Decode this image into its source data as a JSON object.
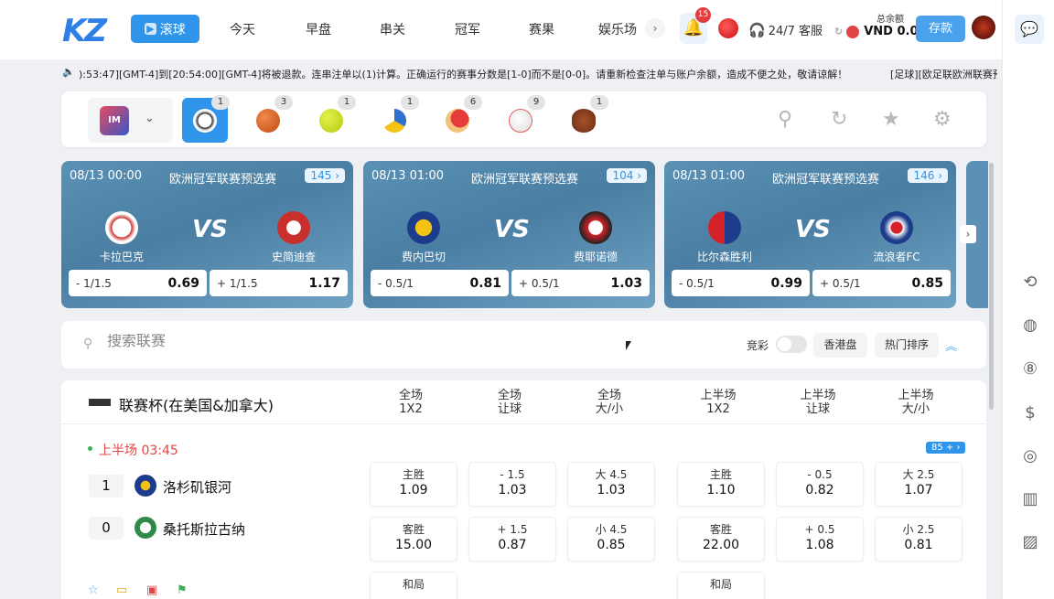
{
  "header": {
    "logo": "KZ",
    "active_nav": "滚球",
    "nav": [
      "今天",
      "早盘",
      "串关",
      "冠军",
      "赛果",
      "娱乐场"
    ],
    "notifications": "15",
    "support": "24/7 客服",
    "balance_label": "总余额",
    "balance": "VND 0.00",
    "deposit": "存款"
  },
  "marquee": {
    "text": "):53:47][GMT-4]到[20:54:00][GMT-4]将被退款。连串注单以(1)计算。正确运行的赛事分数是[1-0]而不是[0-0]。请重新检查注单与账户余额，造成不便之处，敬请谅解！",
    "text2": "[足球][欧足联欧洲联赛预"
  },
  "sports": {
    "counts": [
      "1",
      "3",
      "1",
      "1",
      "6",
      "9",
      "1"
    ],
    "icons": [
      "soccer-icon",
      "basketball-icon",
      "tennis-icon",
      "volleyball-icon",
      "table-tennis-icon",
      "baseball-icon",
      "american-football-icon"
    ]
  },
  "featured": [
    {
      "datetime": "08/13 00:00",
      "league": "欧洲冠军联赛预选赛",
      "markets": "145",
      "home": "卡拉巴克",
      "away": "史简迪查",
      "vs": "VS",
      "odds": [
        {
          "label": "- 1/1.5",
          "value": "0.69"
        },
        {
          "label": "+ 1/1.5",
          "value": "1.17"
        }
      ]
    },
    {
      "datetime": "08/13 01:00",
      "league": "欧洲冠军联赛预选赛",
      "markets": "104",
      "home": "费内巴切",
      "away": "费耶诺德",
      "vs": "VS",
      "odds": [
        {
          "label": "- 0.5/1",
          "value": "0.81"
        },
        {
          "label": "+ 0.5/1",
          "value": "1.03"
        }
      ]
    },
    {
      "datetime": "08/13 01:00",
      "league": "欧洲冠军联赛预选赛",
      "markets": "146",
      "home": "比尔森胜利",
      "away": "流浪者FC",
      "vs": "VS",
      "odds": [
        {
          "label": "- 0.5/1",
          "value": "0.99"
        },
        {
          "label": "+ 0.5/1",
          "value": "0.85"
        }
      ]
    }
  ],
  "search": {
    "placeholder": "搜索联赛",
    "lottery": "竞彩",
    "odds_type": "香港盘",
    "sort": "热门排序"
  },
  "league": {
    "name": "联赛杯(在美国&加拿大)",
    "columns": [
      [
        "全场",
        "1X2"
      ],
      [
        "全场",
        "让球"
      ],
      [
        "全场",
        "大/小"
      ],
      [
        "上半场",
        "1X2"
      ],
      [
        "上半场",
        "让球"
      ],
      [
        "上半场",
        "大/小"
      ]
    ]
  },
  "event": {
    "phase": "上半场 03:45",
    "markets": "85 + ›",
    "home": {
      "score": "1",
      "name": "洛杉矶银河"
    },
    "away": {
      "score": "0",
      "name": "桑托斯拉古纳"
    },
    "home_odds": [
      {
        "l": "主胜",
        "v": "1.09"
      },
      {
        "l": "- 1.5",
        "v": "1.03"
      },
      {
        "l": "大 4.5",
        "v": "1.03"
      },
      {
        "l": "主胜",
        "v": "1.10"
      },
      {
        "l": "- 0.5",
        "v": "0.82"
      },
      {
        "l": "大 2.5",
        "v": "1.07"
      }
    ],
    "away_odds": [
      {
        "l": "客胜",
        "v": "15.00"
      },
      {
        "l": "+ 1.5",
        "v": "0.87"
      },
      {
        "l": "小 4.5",
        "v": "0.85"
      },
      {
        "l": "客胜",
        "v": "22.00"
      },
      {
        "l": "+ 0.5",
        "v": "1.08"
      },
      {
        "l": "小 2.5",
        "v": "0.81"
      }
    ],
    "draw": [
      {
        "l": "和局"
      },
      {
        "l": "和局"
      }
    ]
  }
}
